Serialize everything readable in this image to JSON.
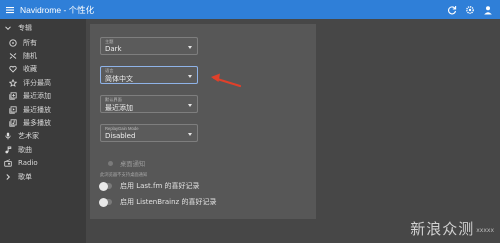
{
  "appbar": {
    "title": "Navidrome - 个性化",
    "bg_color": "#2f7fd8"
  },
  "sidebar": {
    "group_album": "专辑",
    "items": [
      {
        "label": "所有",
        "icon": "album-icon"
      },
      {
        "label": "随机",
        "icon": "shuffle-icon"
      },
      {
        "label": "收藏",
        "icon": "heart-icon"
      },
      {
        "label": "评分最高",
        "icon": "star-icon"
      },
      {
        "label": "最近添加",
        "icon": "library-add-icon"
      },
      {
        "label": "最近播放",
        "icon": "video-library-icon"
      },
      {
        "label": "最多播放",
        "icon": "library-music-icon"
      }
    ],
    "artists": "艺术家",
    "songs": "歌曲",
    "radio": "Radio",
    "group_playlist": "歌单"
  },
  "settings": {
    "theme": {
      "label": "主题",
      "value": "Dark"
    },
    "language": {
      "label": "语言",
      "value": "简体中文"
    },
    "default_view": {
      "label": "默认界面",
      "value": "最近添加"
    },
    "replaygain": {
      "label": "ReplayGain Mode",
      "value": "Disabled"
    },
    "desktop_notifications": "桌面通知",
    "browser_hint": "此浏览器不支持桌面通知",
    "lastfm": "启用 Last.fm 的喜好记录",
    "listenbrainz": "启用 ListenBrainz 的喜好记录"
  },
  "watermark": {
    "chinese": "新浪众测",
    "english": "xxxxx"
  },
  "colors": {
    "accent": "#2f7fd8",
    "arrow": "#e0402a"
  }
}
